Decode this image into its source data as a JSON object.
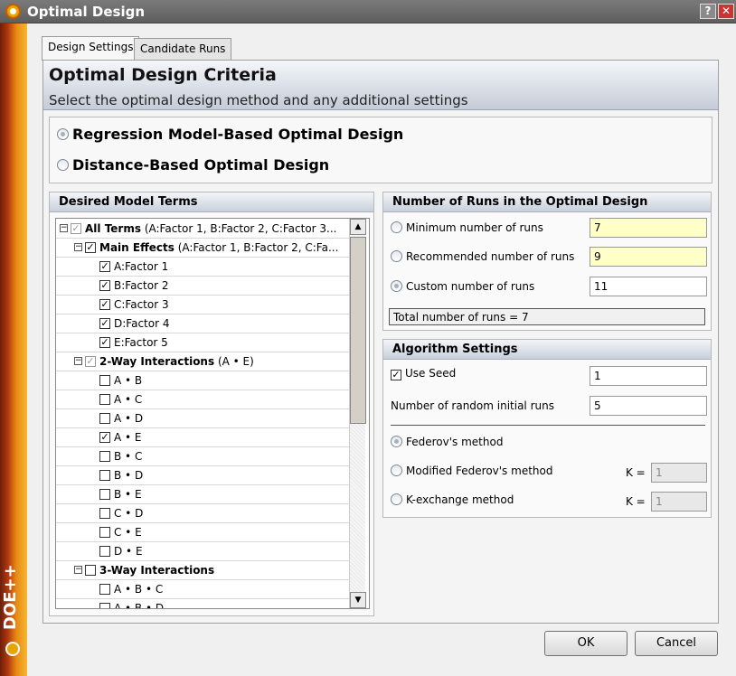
{
  "window": {
    "title": "Optimal Design"
  },
  "brand": {
    "side_text": "DOE++"
  },
  "tabs": [
    {
      "label": "Design Settings",
      "active": true
    },
    {
      "label": "Candidate Runs",
      "active": false
    }
  ],
  "header": {
    "title": "Optimal Design Criteria",
    "subtitle": "Select the optimal design method and any additional settings"
  },
  "design_method": {
    "options": [
      {
        "label": "Regression Model-Based Optimal Design",
        "selected": true
      },
      {
        "label": "Distance-Based Optimal Design",
        "selected": false
      }
    ]
  },
  "model_terms": {
    "heading": "Desired Model Terms",
    "rows": [
      {
        "text": "All Terms",
        "extra": "(A:Factor 1, B:Factor 2, C:Factor 3...",
        "bold": true,
        "checked": true,
        "grey": true,
        "expander": true,
        "level": 0
      },
      {
        "text": "Main Effects",
        "extra": "(A:Factor 1, B:Factor 2, C:Fa...",
        "bold": true,
        "checked": true,
        "grey": false,
        "expander": true,
        "level": 1
      },
      {
        "text": "A:Factor 1",
        "extra": "",
        "bold": false,
        "checked": true,
        "grey": false,
        "expander": false,
        "level": 2
      },
      {
        "text": "B:Factor 2",
        "extra": "",
        "bold": false,
        "checked": true,
        "grey": false,
        "expander": false,
        "level": 2
      },
      {
        "text": "C:Factor 3",
        "extra": "",
        "bold": false,
        "checked": true,
        "grey": false,
        "expander": false,
        "level": 2
      },
      {
        "text": "D:Factor 4",
        "extra": "",
        "bold": false,
        "checked": true,
        "grey": false,
        "expander": false,
        "level": 2
      },
      {
        "text": "E:Factor 5",
        "extra": "",
        "bold": false,
        "checked": true,
        "grey": false,
        "expander": false,
        "level": 2
      },
      {
        "text": "2-Way Interactions",
        "extra": "(A • E)",
        "bold": true,
        "checked": true,
        "grey": true,
        "expander": true,
        "level": 1
      },
      {
        "text": "A • B",
        "extra": "",
        "bold": false,
        "checked": false,
        "grey": false,
        "expander": false,
        "level": 2
      },
      {
        "text": "A • C",
        "extra": "",
        "bold": false,
        "checked": false,
        "grey": false,
        "expander": false,
        "level": 2
      },
      {
        "text": "A • D",
        "extra": "",
        "bold": false,
        "checked": false,
        "grey": false,
        "expander": false,
        "level": 2
      },
      {
        "text": "A • E",
        "extra": "",
        "bold": false,
        "checked": true,
        "grey": false,
        "expander": false,
        "level": 2
      },
      {
        "text": "B • C",
        "extra": "",
        "bold": false,
        "checked": false,
        "grey": false,
        "expander": false,
        "level": 2
      },
      {
        "text": "B • D",
        "extra": "",
        "bold": false,
        "checked": false,
        "grey": false,
        "expander": false,
        "level": 2
      },
      {
        "text": "B • E",
        "extra": "",
        "bold": false,
        "checked": false,
        "grey": false,
        "expander": false,
        "level": 2
      },
      {
        "text": "C • D",
        "extra": "",
        "bold": false,
        "checked": false,
        "grey": false,
        "expander": false,
        "level": 2
      },
      {
        "text": "C • E",
        "extra": "",
        "bold": false,
        "checked": false,
        "grey": false,
        "expander": false,
        "level": 2
      },
      {
        "text": "D • E",
        "extra": "",
        "bold": false,
        "checked": false,
        "grey": false,
        "expander": false,
        "level": 2
      },
      {
        "text": "3-Way Interactions",
        "extra": "",
        "bold": true,
        "checked": false,
        "grey": false,
        "expander": true,
        "level": 1
      },
      {
        "text": "A • B • C",
        "extra": "",
        "bold": false,
        "checked": false,
        "grey": false,
        "expander": false,
        "level": 2
      },
      {
        "text": "A • B • D",
        "extra": "",
        "bold": false,
        "checked": false,
        "grey": false,
        "expander": false,
        "level": 2
      }
    ]
  },
  "runs": {
    "heading": "Number of Runs in the Optimal Design",
    "min_label": "Minimum number of runs",
    "min_value": "7",
    "rec_label": "Recommended number of runs",
    "rec_value": "9",
    "custom_label": "Custom number of runs",
    "custom_value": "11",
    "total": "Total number of runs = 7",
    "selected": "custom"
  },
  "algorithm": {
    "heading": "Algorithm Settings",
    "use_seed_label": "Use Seed",
    "use_seed_checked": true,
    "seed_value": "1",
    "random_runs_label": "Number of random initial runs",
    "random_runs_value": "5",
    "methods": [
      {
        "label": "Federov's method",
        "selected": true,
        "k": null
      },
      {
        "label": "Modified Federov's method",
        "selected": false,
        "k": "1"
      },
      {
        "label": "K-exchange method",
        "selected": false,
        "k": "1"
      }
    ],
    "k_label": "K ="
  },
  "buttons": {
    "ok": "OK",
    "cancel": "Cancel"
  }
}
